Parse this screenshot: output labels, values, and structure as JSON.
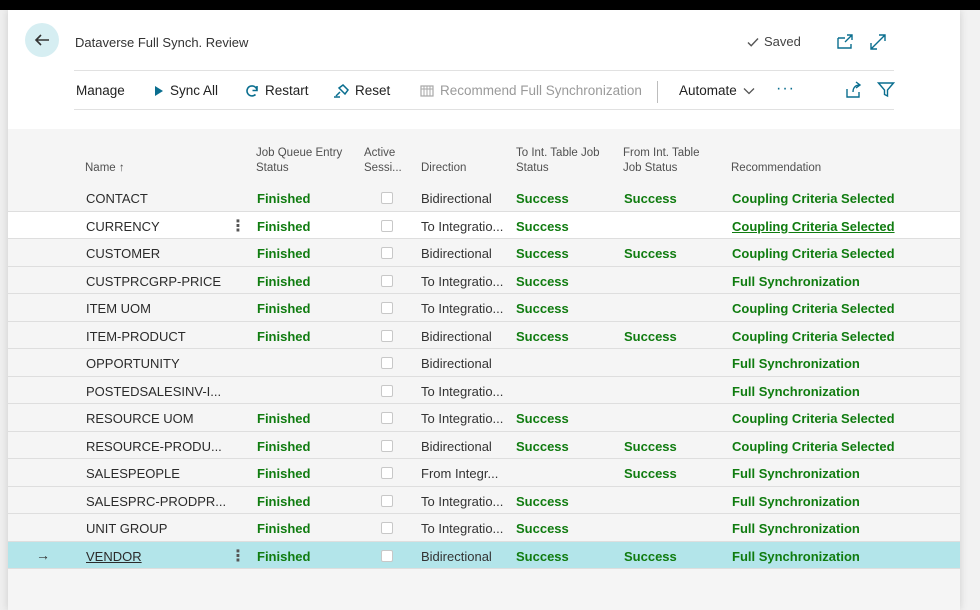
{
  "header": {
    "title": "Dataverse Full Synch. Review",
    "saved_label": "Saved"
  },
  "actions": {
    "manage": "Manage",
    "sync_all": "Sync All",
    "restart": "Restart",
    "reset": "Reset",
    "recommend": "Recommend Full Synchronization",
    "automate": "Automate",
    "more": "···"
  },
  "columns": {
    "name": "Name ↑",
    "jq_status_1": "Job Queue Entry",
    "jq_status_2": "Status",
    "active_1": "Active",
    "active_2": "Sessi...",
    "direction": "Direction",
    "to_int_1": "To Int. Table Job",
    "to_int_2": "Status",
    "from_int_1": "From Int. Table",
    "from_int_2": "Job Status",
    "recommendation": "Recommendation"
  },
  "rows": [
    {
      "name": "CONTACT",
      "jq": "Finished",
      "direction": "Bidirectional",
      "to": "Success",
      "from": "Success",
      "rec": "Coupling Criteria Selected"
    },
    {
      "name": "CURRENCY",
      "jq": "Finished",
      "direction": "To Integratio...",
      "to": "Success",
      "from": "",
      "rec": "Coupling Criteria Selected"
    },
    {
      "name": "CUSTOMER",
      "jq": "Finished",
      "direction": "Bidirectional",
      "to": "Success",
      "from": "Success",
      "rec": "Coupling Criteria Selected"
    },
    {
      "name": "CUSTPRCGRP-PRICE",
      "jq": "Finished",
      "direction": "To Integratio...",
      "to": "Success",
      "from": "",
      "rec": "Full Synchronization"
    },
    {
      "name": "ITEM UOM",
      "jq": "Finished",
      "direction": "To Integratio...",
      "to": "Success",
      "from": "",
      "rec": "Coupling Criteria Selected"
    },
    {
      "name": "ITEM-PRODUCT",
      "jq": "Finished",
      "direction": "Bidirectional",
      "to": "Success",
      "from": "Success",
      "rec": "Coupling Criteria Selected"
    },
    {
      "name": "OPPORTUNITY",
      "jq": "",
      "direction": "Bidirectional",
      "to": "",
      "from": "",
      "rec": "Full Synchronization"
    },
    {
      "name": "POSTEDSALESINV-I...",
      "jq": "",
      "direction": "To Integratio...",
      "to": "",
      "from": "",
      "rec": "Full Synchronization"
    },
    {
      "name": "RESOURCE UOM",
      "jq": "Finished",
      "direction": "To Integratio...",
      "to": "Success",
      "from": "",
      "rec": "Coupling Criteria Selected"
    },
    {
      "name": "RESOURCE-PRODU...",
      "jq": "Finished",
      "direction": "Bidirectional",
      "to": "Success",
      "from": "Success",
      "rec": "Coupling Criteria Selected"
    },
    {
      "name": "SALESPEOPLE",
      "jq": "Finished",
      "direction": "From Integr...",
      "to": "",
      "from": "Success",
      "rec": "Full Synchronization"
    },
    {
      "name": "SALESPRC-PRODPR...",
      "jq": "Finished",
      "direction": "To Integratio...",
      "to": "Success",
      "from": "",
      "rec": "Full Synchronization"
    },
    {
      "name": "UNIT GROUP",
      "jq": "Finished",
      "direction": "To Integratio...",
      "to": "Success",
      "from": "",
      "rec": "Full Synchronization"
    },
    {
      "name": "VENDOR",
      "jq": "Finished",
      "direction": "Bidirectional",
      "to": "Success",
      "from": "Success",
      "rec": "Full Synchronization"
    }
  ],
  "row_state": {
    "hover_index": 1,
    "selected_index": 13
  },
  "colors": {
    "accent_green": "#107c10",
    "selected_row": "#b3e5ea",
    "back_button": "#d6eef2",
    "icon_blue": "#0a6e8f"
  },
  "icons": {
    "back": "arrow-left-icon",
    "saved": "checkmark-icon",
    "open_new": "open-in-new-window-icon",
    "expand": "expand-icon",
    "sync_all": "play-icon",
    "restart": "refresh-icon",
    "reset": "reset-icon",
    "recommend": "recommend-icon",
    "share": "share-icon",
    "filter": "filter-icon"
  }
}
